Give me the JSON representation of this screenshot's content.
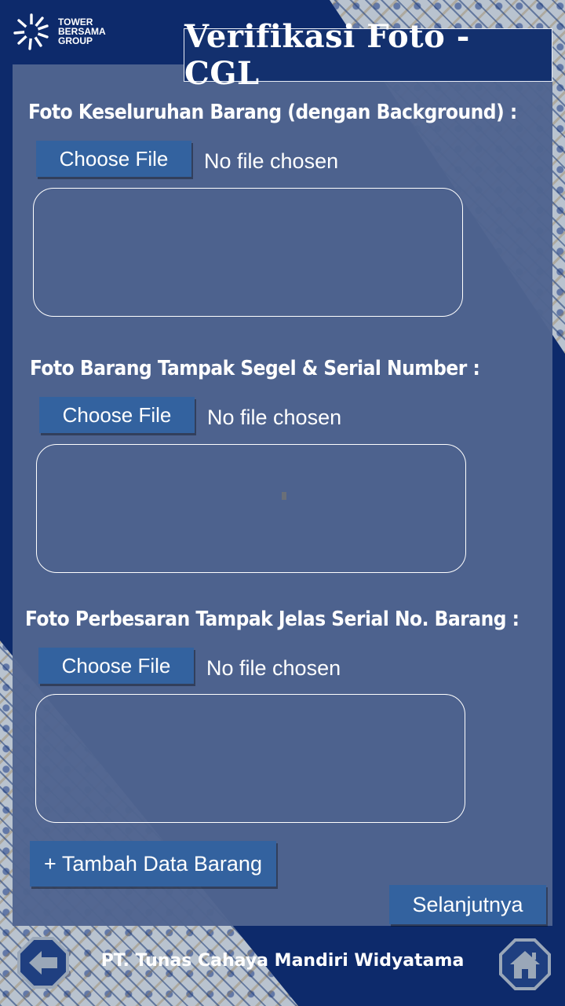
{
  "brand": {
    "logo_lines": [
      "TOWER",
      "BERSAMA",
      "GROUP"
    ]
  },
  "header": {
    "title": "Verifikasi Foto - CGL"
  },
  "sections": [
    {
      "label": "Foto Keseluruhan Barang (dengan Background) :",
      "button": "Choose File",
      "status": "No file chosen"
    },
    {
      "label": "Foto Barang Tampak Segel & Serial Number :",
      "button": "Choose File",
      "status": "No file chosen"
    },
    {
      "label": "Foto Perbesaran Tampak Jelas Serial No. Barang :",
      "button": "Choose File",
      "status": "No file chosen"
    }
  ],
  "actions": {
    "add_label": "+ Tambah Data Barang",
    "next_label": "Selanjutnya"
  },
  "footer": {
    "company": "PT. Tunas Cahaya Mandiri Widyatama"
  },
  "icons": {
    "back": "back-arrow-icon",
    "home": "home-icon"
  },
  "colors": {
    "background": "#0d2a6b",
    "panel": "#4f6490",
    "button": "#33629f",
    "title_bg": "#13306e"
  }
}
